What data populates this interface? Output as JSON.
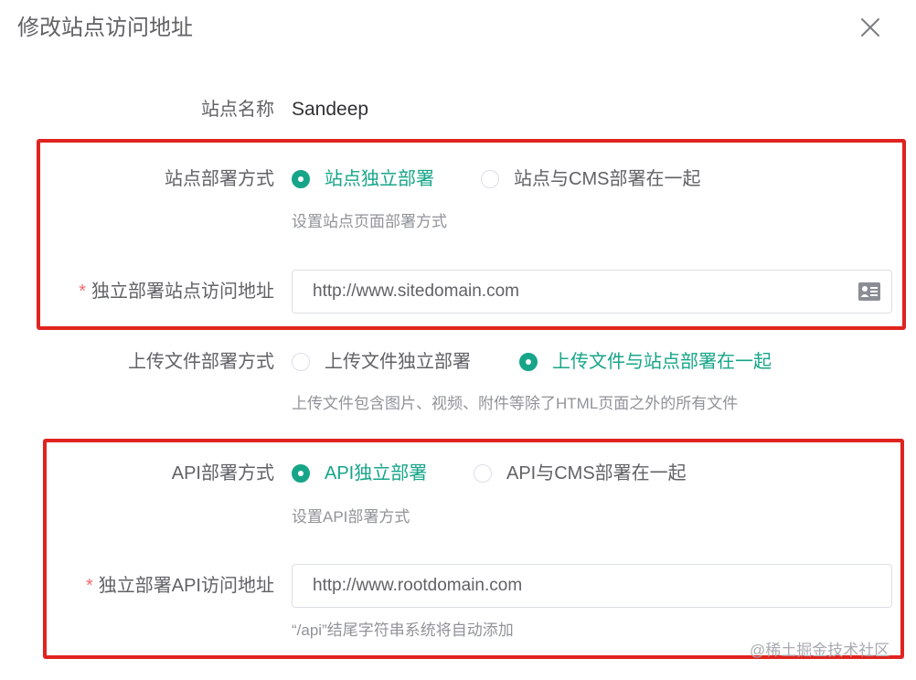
{
  "dialog": {
    "title": "修改站点访问地址"
  },
  "form": {
    "site_name": {
      "label": "站点名称",
      "value": "Sandeep"
    },
    "site_deploy": {
      "label": "站点部署方式",
      "options": [
        "站点独立部署",
        "站点与CMS部署在一起"
      ],
      "selected_index": 0,
      "hint": "设置站点页面部署方式"
    },
    "site_url": {
      "label": "独立部署站点访问地址",
      "required_mark": "*",
      "value": "http://www.sitedomain.com",
      "suffix_icon": "contact-card-icon"
    },
    "upload_deploy": {
      "label": "上传文件部署方式",
      "options": [
        "上传文件独立部署",
        "上传文件与站点部署在一起"
      ],
      "selected_index": 1,
      "hint": "上传文件包含图片、视频、附件等除了HTML页面之外的所有文件"
    },
    "api_deploy": {
      "label": "API部署方式",
      "options": [
        "API独立部署",
        "API与CMS部署在一起"
      ],
      "selected_index": 0,
      "hint": "设置API部署方式"
    },
    "api_url": {
      "label": "独立部署API访问地址",
      "required_mark": "*",
      "value": "http://www.rootdomain.com",
      "hint": "“/api”结尾字符串系统将自动添加"
    }
  },
  "watermark": "@稀土掘金技术社区",
  "colors": {
    "accent": "#17a589",
    "required": "#f56c6c",
    "highlight_box": "#e0231f",
    "label": "#606266",
    "hint": "#909399"
  }
}
